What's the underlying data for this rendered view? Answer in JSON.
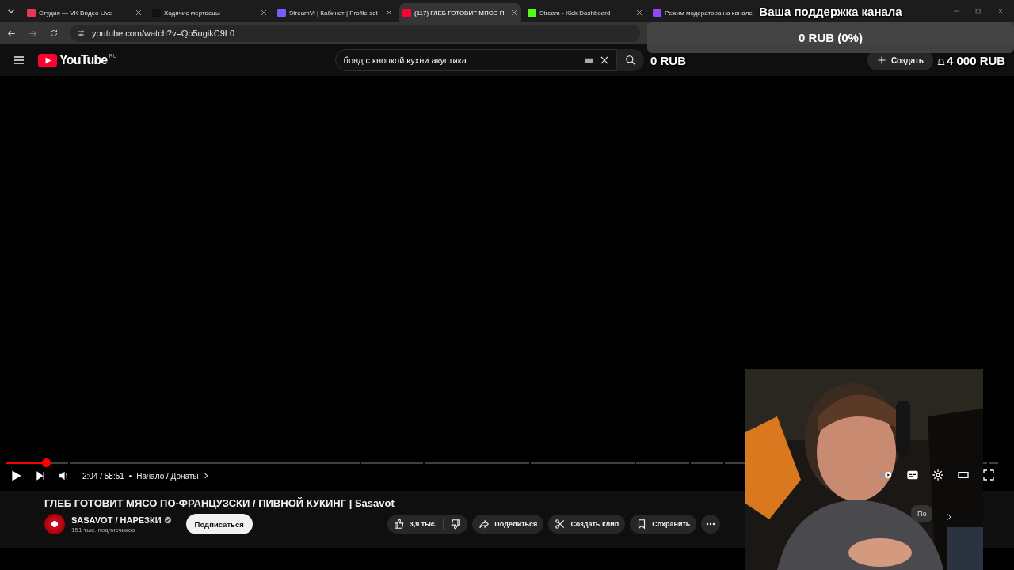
{
  "browser": {
    "tabs": [
      {
        "title": "Студия — VK Видео Live",
        "selected": false
      },
      {
        "title": "Ходячие мертвецы",
        "selected": false
      },
      {
        "title": "StreamVi | Кабинет | Profile set",
        "selected": false
      },
      {
        "title": "(117) ГЛЕБ ГОТОВИТ МЯСО П",
        "selected": true
      },
      {
        "title": "Stream - Kick Dashboard",
        "selected": false
      },
      {
        "title": "Режим модератора на канале",
        "selected": false
      }
    ],
    "url": "youtube.com/watch?v=Qb5ugikC9L0"
  },
  "youtube": {
    "logo_text": "YouTube",
    "region": "RU",
    "search": {
      "value": "бонд с кнопкой кухни акустика"
    },
    "create_button": "Создать"
  },
  "player": {
    "progress": {
      "level": 0.04
    },
    "time": "2:04 / 58:51",
    "separator": "•",
    "chapter": "Начало / Донаты"
  },
  "video": {
    "title": "ГЛЕБ ГОТОВИТ МЯСО ПО-ФРАНЦУЗСКИ / ПИВНОЙ КУКИНГ | Sasavot",
    "channel": {
      "name": "SASAVOT / НАРЕЗКИ",
      "verified": true,
      "subscribers": "151 тыс. подписчиков"
    },
    "subscribe_button": "Подписаться",
    "likes": "3,9 тыс.",
    "actions": [
      {
        "kind": "share",
        "label": "Поделиться"
      },
      {
        "kind": "clip",
        "label": "Создать клип"
      },
      {
        "kind": "save",
        "label": "Сохранить"
      }
    ]
  },
  "side_chip": "По",
  "overlay": {
    "donation_title": "Ваша поддержка канала",
    "donation_amount": "0 RUB (0%)",
    "counter_left": "0 RUB",
    "counter_right": "4 000 RUB"
  }
}
